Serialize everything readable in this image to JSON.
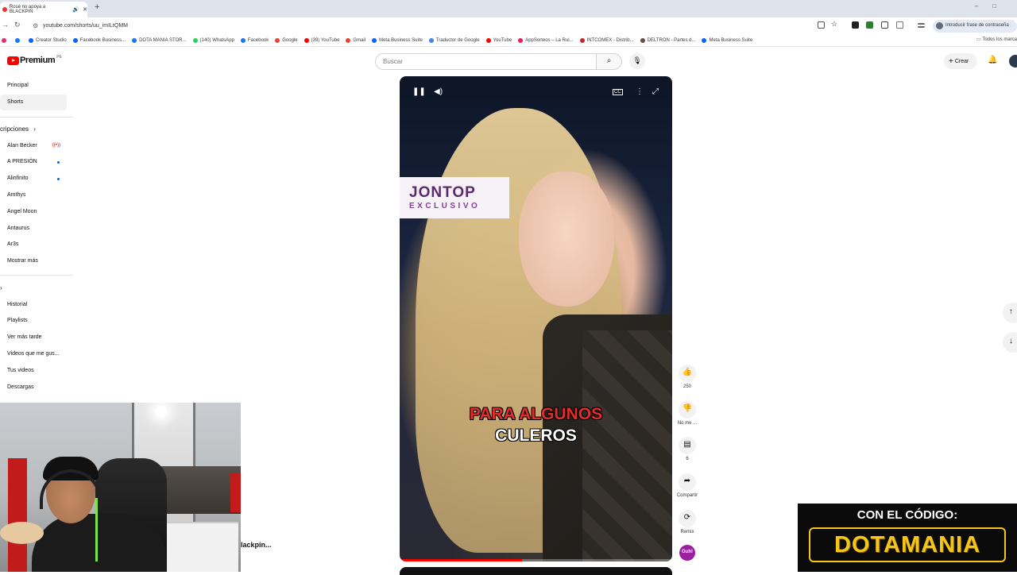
{
  "browser": {
    "tab_title": "Rosé no apoya a BLACKPIN",
    "url": "youtube.com/shorts/uu_imILtQMM",
    "password_hint": "Introducir frase de contraseña",
    "all_bookmarks": "Todos los marca",
    "bookmarks": [
      {
        "label": "Creator Studio",
        "color": "#0866ff"
      },
      {
        "label": "Facebook Business...",
        "color": "#0866ff"
      },
      {
        "label": "DOTA MANIA STOR...",
        "color": "#1877f2"
      },
      {
        "label": "(140) WhatsApp",
        "color": "#25d366"
      },
      {
        "label": "Facebook",
        "color": "#1877f2"
      },
      {
        "label": "Google",
        "color": "#ea4335"
      },
      {
        "label": "(39) YouTube",
        "color": "#ff0000"
      },
      {
        "label": "Gmail",
        "color": "#ea4335"
      },
      {
        "label": "Meta Business Suite",
        "color": "#0866ff"
      },
      {
        "label": "Traductor de Google",
        "color": "#4285f4"
      },
      {
        "label": "YouTube",
        "color": "#ff0000"
      },
      {
        "label": "AppSorteos – La Rul...",
        "color": "#e91e63"
      },
      {
        "label": "INTCOMEX - Distrib...",
        "color": "#c62828"
      },
      {
        "label": "DELTRON - Partes d...",
        "color": "#6d4c41"
      },
      {
        "label": "Meta Business Suite",
        "color": "#0866ff"
      }
    ]
  },
  "header": {
    "logo_text": "Premium",
    "logo_sup": "PE",
    "search_placeholder": "Buscar",
    "create_label": "Crear"
  },
  "sidebar": {
    "main": [
      "Principal",
      "Shorts"
    ],
    "subs_heading": "cripciones",
    "subs": [
      "Alan Becker",
      "A PRESIÓN",
      "Alinfinito",
      "Amthys",
      "Angel Moon",
      "Antaurus",
      "Ar3s",
      "Mostrar más"
    ],
    "you": [
      "Historial",
      "Playlists",
      "Ver más tarde",
      "Videos que me gus...",
      "Tus videos",
      "Descargas"
    ]
  },
  "video": {
    "brand_top": "JONTOP",
    "brand_bottom": "EXCLUSIVO",
    "caption_line1": "PARA ALGUNOS",
    "caption_line2": "CULEROS",
    "progress": 0.45
  },
  "actions": {
    "likes": "250",
    "dislike": "No me ...",
    "comments": "6",
    "share": "Compartir",
    "remix": "Remix",
    "channel_initials": "Ouh!"
  },
  "overlay": {
    "partial_title": "lackpin...",
    "promo_line1": "CON EL CÓDIGO:",
    "promo_line2": "DOTAMANIA"
  }
}
